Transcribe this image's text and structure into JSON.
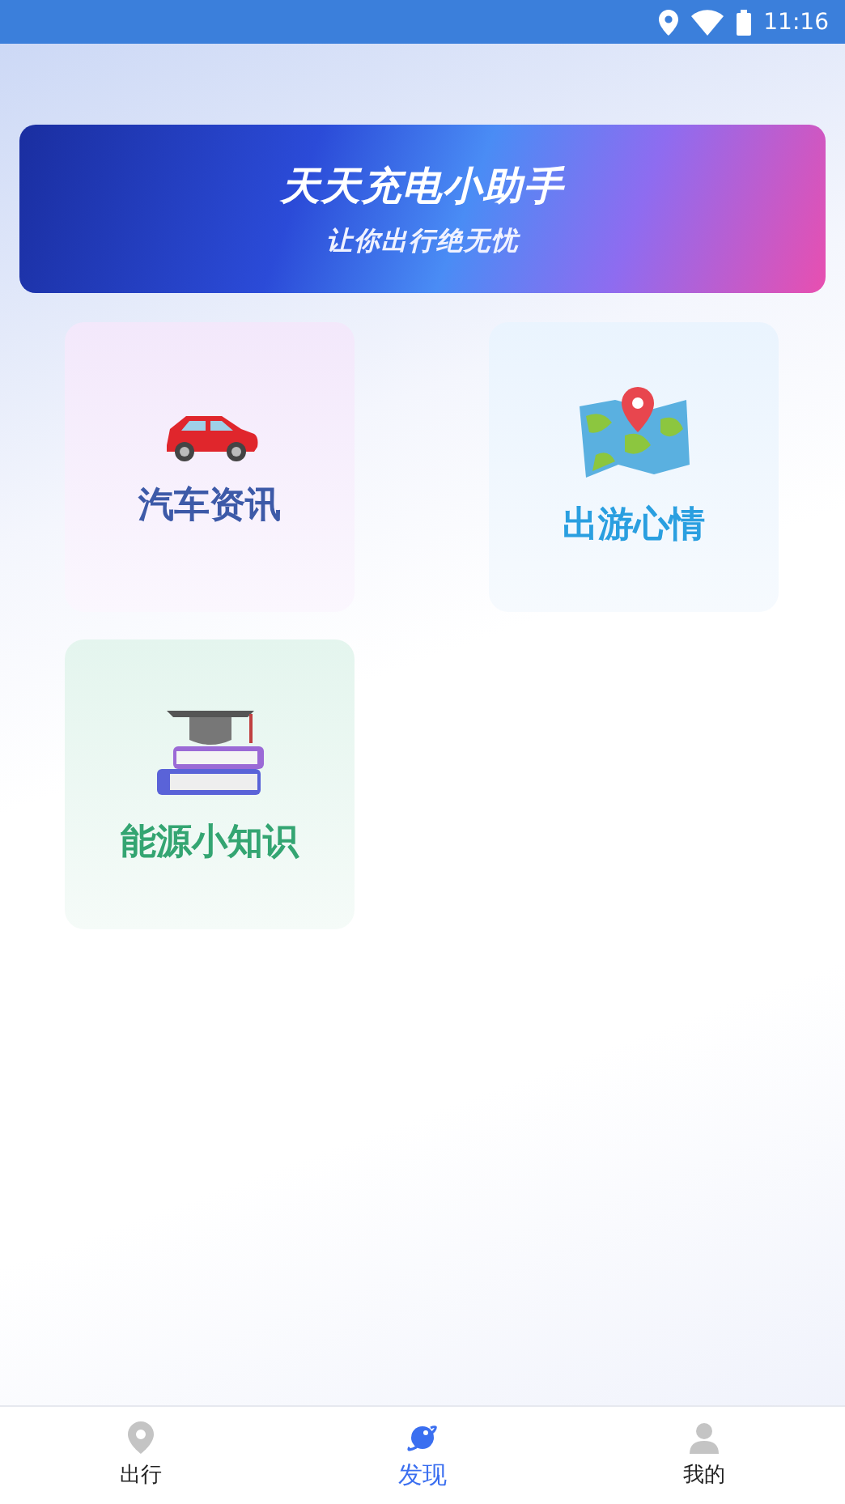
{
  "status_bar": {
    "time": "11:16"
  },
  "banner": {
    "title": "天天充电小助手",
    "subtitle": "让你出行绝无忧"
  },
  "tiles": [
    {
      "kind": "car",
      "label": "汽车资讯",
      "color": "#3d5aa8"
    },
    {
      "kind": "map",
      "label": "出游心情",
      "color": "#2a9fe0"
    },
    {
      "kind": "books",
      "label": "能源小知识",
      "color": "#34a572"
    }
  ],
  "nav": [
    {
      "kind": "pin",
      "label": "出行",
      "selected": false
    },
    {
      "kind": "planet",
      "label": "发现",
      "selected": true
    },
    {
      "kind": "person",
      "label": "我的",
      "selected": false
    }
  ]
}
